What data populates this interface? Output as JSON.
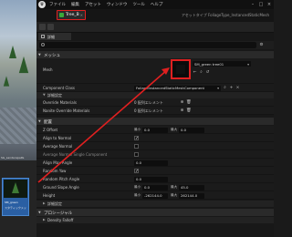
{
  "viewport": {
    "landscape_label": "SG_LandscapePe",
    "asset_thumb_line1": "SM_green",
    "asset_thumb_line2": "スタティックメッ"
  },
  "titlebar": {
    "menu": [
      "ファイル",
      "編集",
      "アセット",
      "ウィンドウ",
      "ツール",
      "ヘルプ"
    ]
  },
  "asset_tab": {
    "label": "Tree_B",
    "asset_type": "アセットタイプ FoliageType_InstancedStaticMesh"
  },
  "details_tab": {
    "label": "詳細"
  },
  "sections": {
    "mesh": "メッシュ",
    "mesh_advanced": "詳細設定",
    "placement": "配置",
    "placement_advanced": "詳細設定",
    "procedural": "プロシージャル",
    "density": "Density Falloff"
  },
  "mesh": {
    "mesh_label": "Mesh",
    "mesh_value": "SM_green tree01",
    "component_class_label": "Component Class",
    "component_class_value": "FoliageInstancedStaticMeshComponent"
  },
  "advanced": {
    "override_materials_label": "Override Materials",
    "override_materials_value": "0 配列エレメント",
    "nanite_override_label": "Nanite Override Materials",
    "nanite_override_value": "0 配列エレメント"
  },
  "placement": {
    "z_offset_label": "Z Offset",
    "z_offset_min_label": "最小",
    "z_offset_min": "0.0",
    "z_offset_max_label": "最大",
    "z_offset_max": "0.0",
    "align_to_normal_label": "Align to Normal",
    "average_normal_label": "Average Normal",
    "average_normal_single_label": "Average Normal Single Component",
    "align_max_angle_label": "Align Max Angle",
    "align_max_angle": "0.0",
    "random_yaw_label": "Random Yaw",
    "random_pitch_label": "Random Pitch Angle",
    "random_pitch": "0.0",
    "ground_slope_label": "Ground Slope Angle",
    "ground_slope_min_label": "最小",
    "ground_slope_min": "0.0",
    "ground_slope_max_label": "最大",
    "ground_slope_max": "45.0",
    "height_label": "Height",
    "height_min_label": "最小",
    "height_min": "-262144.0",
    "height_max_label": "最大",
    "height_max": "262144.0"
  },
  "colors": {
    "highlight": "#e02020",
    "tab_green": "#3aa83a",
    "thumb_blue": "#2a5fa3"
  }
}
